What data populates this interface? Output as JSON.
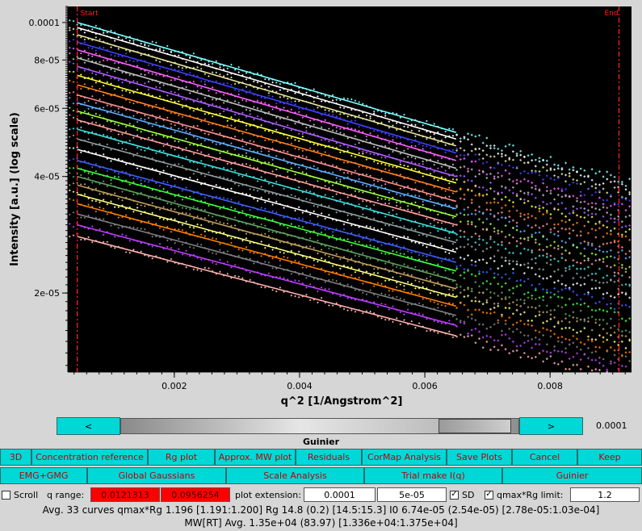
{
  "chart_data": {
    "type": "scatter",
    "title": "",
    "xlabel": "q^2 [1/Angstrom^2]",
    "ylabel": "Intensity [a.u.] (log scale)",
    "y_scale": "log",
    "xlim": [
      0.0003,
      0.0093
    ],
    "ylim": [
      1.25e-05,
      0.00011
    ],
    "x_ticks": [
      {
        "value": 0.002,
        "label": "0.002"
      },
      {
        "value": 0.004,
        "label": "0.004"
      },
      {
        "value": 0.006,
        "label": "0.006"
      },
      {
        "value": 0.008,
        "label": "0.008"
      }
    ],
    "y_ticks": [
      {
        "value": 2e-05,
        "label": "2e-05"
      },
      {
        "value": 4e-05,
        "label": "4e-05"
      },
      {
        "value": 6e-05,
        "label": "6e-05"
      },
      {
        "value": 8e-05,
        "label": "8e-05"
      },
      {
        "value": 0.0001,
        "label": "0.0001"
      }
    ],
    "grid": false,
    "background": "#000000",
    "range_markers": [
      {
        "label": "Start",
        "x": 0.00045,
        "color": "#ff2020"
      },
      {
        "label": "End",
        "x": 0.0091,
        "color": "#ff2020"
      }
    ],
    "fit_x_range": [
      0.00045,
      0.0065
    ],
    "series": [
      {
        "color": "#7fffff",
        "y_start": 0.0001,
        "y_end": 5.2e-05
      },
      {
        "color": "#ffffff",
        "y_start": 9.7e-05,
        "y_end": 5e-05
      },
      {
        "color": "#e8e8a0",
        "y_start": 9.3e-05,
        "y_end": 4.8e-05
      },
      {
        "color": "#4040ff",
        "y_start": 8.9e-05,
        "y_end": 4.6e-05
      },
      {
        "color": "#ff60ff",
        "y_start": 8.5e-05,
        "y_end": 4.4e-05
      },
      {
        "color": "#c0c0c0",
        "y_start": 8.1e-05,
        "y_end": 4.2e-05
      },
      {
        "color": "#b060ff",
        "y_start": 7.7e-05,
        "y_end": 4e-05
      },
      {
        "color": "#ffff40",
        "y_start": 7.3e-05,
        "y_end": 3.85e-05
      },
      {
        "color": "#ff8020",
        "y_start": 6.9e-05,
        "y_end": 3.65e-05
      },
      {
        "color": "#ff9090",
        "y_start": 6.5e-05,
        "y_end": 3.45e-05
      },
      {
        "color": "#60b0ff",
        "y_start": 6.2e-05,
        "y_end": 3.3e-05
      },
      {
        "color": "#a0ff40",
        "y_start": 5.9e-05,
        "y_end": 3.15e-05
      },
      {
        "color": "#ffa0a0",
        "y_start": 5.6e-05,
        "y_end": 3e-05
      },
      {
        "color": "#40e0e0",
        "y_start": 5.3e-05,
        "y_end": 2.85e-05
      },
      {
        "color": "#90a0a0",
        "y_start": 5e-05,
        "y_end": 2.7e-05
      },
      {
        "color": "#ffffff",
        "y_start": 4.7e-05,
        "y_end": 2.55e-05
      },
      {
        "color": "#4060ff",
        "y_start": 4.4e-05,
        "y_end": 2.4e-05
      },
      {
        "color": "#40ff40",
        "y_start": 4.2e-05,
        "y_end": 2.28e-05
      },
      {
        "color": "#60a060",
        "y_start": 4e-05,
        "y_end": 2.15e-05
      },
      {
        "color": "#c0a060",
        "y_start": 3.8e-05,
        "y_end": 2.05e-05
      },
      {
        "color": "#ffff80",
        "y_start": 3.6e-05,
        "y_end": 1.95e-05
      },
      {
        "color": "#ff8000",
        "y_start": 3.4e-05,
        "y_end": 1.85e-05
      },
      {
        "color": "#808080",
        "y_start": 3.2e-05,
        "y_end": 1.75e-05
      },
      {
        "color": "#c040ff",
        "y_start": 3e-05,
        "y_end": 1.65e-05
      },
      {
        "color": "#ffb0b0",
        "y_start": 2.8e-05,
        "y_end": 1.55e-05
      }
    ]
  },
  "slider": {
    "prev_label": "<",
    "next_label": ">",
    "value_label": "0.0001",
    "caption": "Guinier"
  },
  "toolbar_row1": [
    {
      "name": "3d-button",
      "label": "3D"
    },
    {
      "name": "concentration-reference-button",
      "label": "Concentration reference"
    },
    {
      "name": "rg-plot-button",
      "label": "Rg plot"
    },
    {
      "name": "approx-mw-plot-button",
      "label": "Approx. MW plot"
    },
    {
      "name": "residuals-button",
      "label": "Residuals"
    },
    {
      "name": "cormap-analysis-button",
      "label": "CorMap Analysis"
    },
    {
      "name": "save-plots-button",
      "label": "Save Plots"
    },
    {
      "name": "cancel-button",
      "label": "Cancel"
    },
    {
      "name": "keep-button",
      "label": "Keep"
    }
  ],
  "toolbar_row2": [
    {
      "name": "emg-gmg-button",
      "label": "EMG+GMG"
    },
    {
      "name": "global-gaussians-button",
      "label": "Global Gaussians"
    },
    {
      "name": "scale-analysis-button",
      "label": "Scale Analysis"
    },
    {
      "name": "trial-make-iq-button",
      "label": "Trial make I(q)"
    },
    {
      "name": "guinier-button",
      "label": "Guinier"
    }
  ],
  "controls": {
    "scroll_label": "Scroll",
    "q_range_label": "q range:",
    "q_min": "0.0121313",
    "q_max": "0.0956254",
    "plot_extension_label": "plot extension:",
    "plot_extension_value": "0.0001",
    "step_value": "5e-05",
    "sd_label": "SD",
    "sd_checked": "✓",
    "qmax_rg_label": "qmax*Rg limit:",
    "qmax_rg_checked": "✓",
    "qmax_rg_value": "1.2"
  },
  "stats": {
    "line1": "Avg. 33 curves  qmax*Rg 1.196 [1.191:1.200]  Rg 14.8 (0.2) [14.5:15.3]  I0 6.74e-05 (2.54e-05) [2.78e-05:1.03e-04]",
    "line2": "MW[RT] Avg.  1.35e+04 (83.97) [1.336e+04:1.375e+04]"
  }
}
